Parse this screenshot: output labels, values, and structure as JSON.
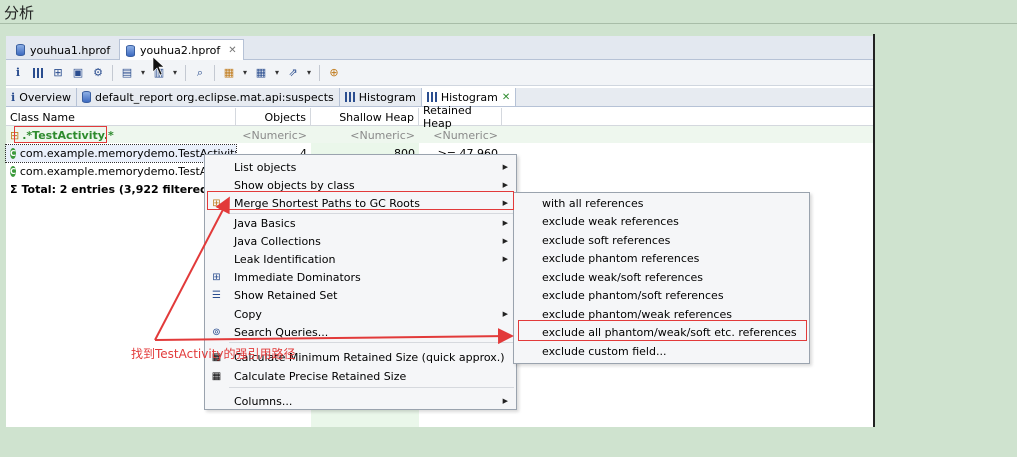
{
  "page": {
    "title": "分析"
  },
  "editor_tabs": [
    {
      "label": "youhua1.hprof"
    },
    {
      "label": "youhua2.hprof"
    }
  ],
  "query_tabs": [
    {
      "label": "Overview"
    },
    {
      "label": "default_report  org.eclipse.mat.api:suspects"
    },
    {
      "label": "Histogram"
    },
    {
      "label": "Histogram"
    }
  ],
  "table": {
    "columns": [
      "Class Name",
      "Objects",
      "Shallow Heap",
      "Retained Heap"
    ],
    "filter_row": {
      "name": ".*TestActivity.*",
      "objects": "<Numeric>",
      "shallow": "<Numeric>",
      "retained": "<Numeric>"
    },
    "rows": [
      {
        "name": "com.example.memorydemo.TestActivity",
        "objects": "4",
        "shallow": "800",
        "retained": ">= 47,960"
      },
      {
        "name": "com.example.memorydemo.TestActivity",
        "objects": "",
        "shallow": "",
        "retained": ""
      }
    ],
    "total": "Total: 2 entries (3,922 filtered)"
  },
  "context_menu": {
    "items": [
      {
        "label": "List objects"
      },
      {
        "label": "Show objects by class"
      },
      {
        "label": "Merge Shortest Paths to GC Roots"
      },
      {
        "label": "Java Basics"
      },
      {
        "label": "Java Collections"
      },
      {
        "label": "Leak Identification"
      },
      {
        "label": "Immediate Dominators"
      },
      {
        "label": "Show Retained Set"
      },
      {
        "label": "Copy"
      },
      {
        "label": "Search Queries..."
      },
      {
        "label": "Calculate Minimum Retained Size (quick approx.)"
      },
      {
        "label": "Calculate Precise Retained Size"
      },
      {
        "label": "Columns..."
      }
    ]
  },
  "submenu": {
    "items": [
      {
        "label": "with all references"
      },
      {
        "label": "exclude weak references"
      },
      {
        "label": "exclude soft references"
      },
      {
        "label": "exclude phantom references"
      },
      {
        "label": "exclude weak/soft references"
      },
      {
        "label": "exclude phantom/soft references"
      },
      {
        "label": "exclude phantom/weak references"
      },
      {
        "label": "exclude all phantom/weak/soft etc. references"
      },
      {
        "label": "exclude custom field..."
      }
    ]
  },
  "annotation": {
    "text": "找到TestActivity的强引用路径"
  },
  "colors": {
    "background": "#cfe3cf",
    "annotation_red": "#e23a3a",
    "class_green": "#3c9a3c"
  }
}
